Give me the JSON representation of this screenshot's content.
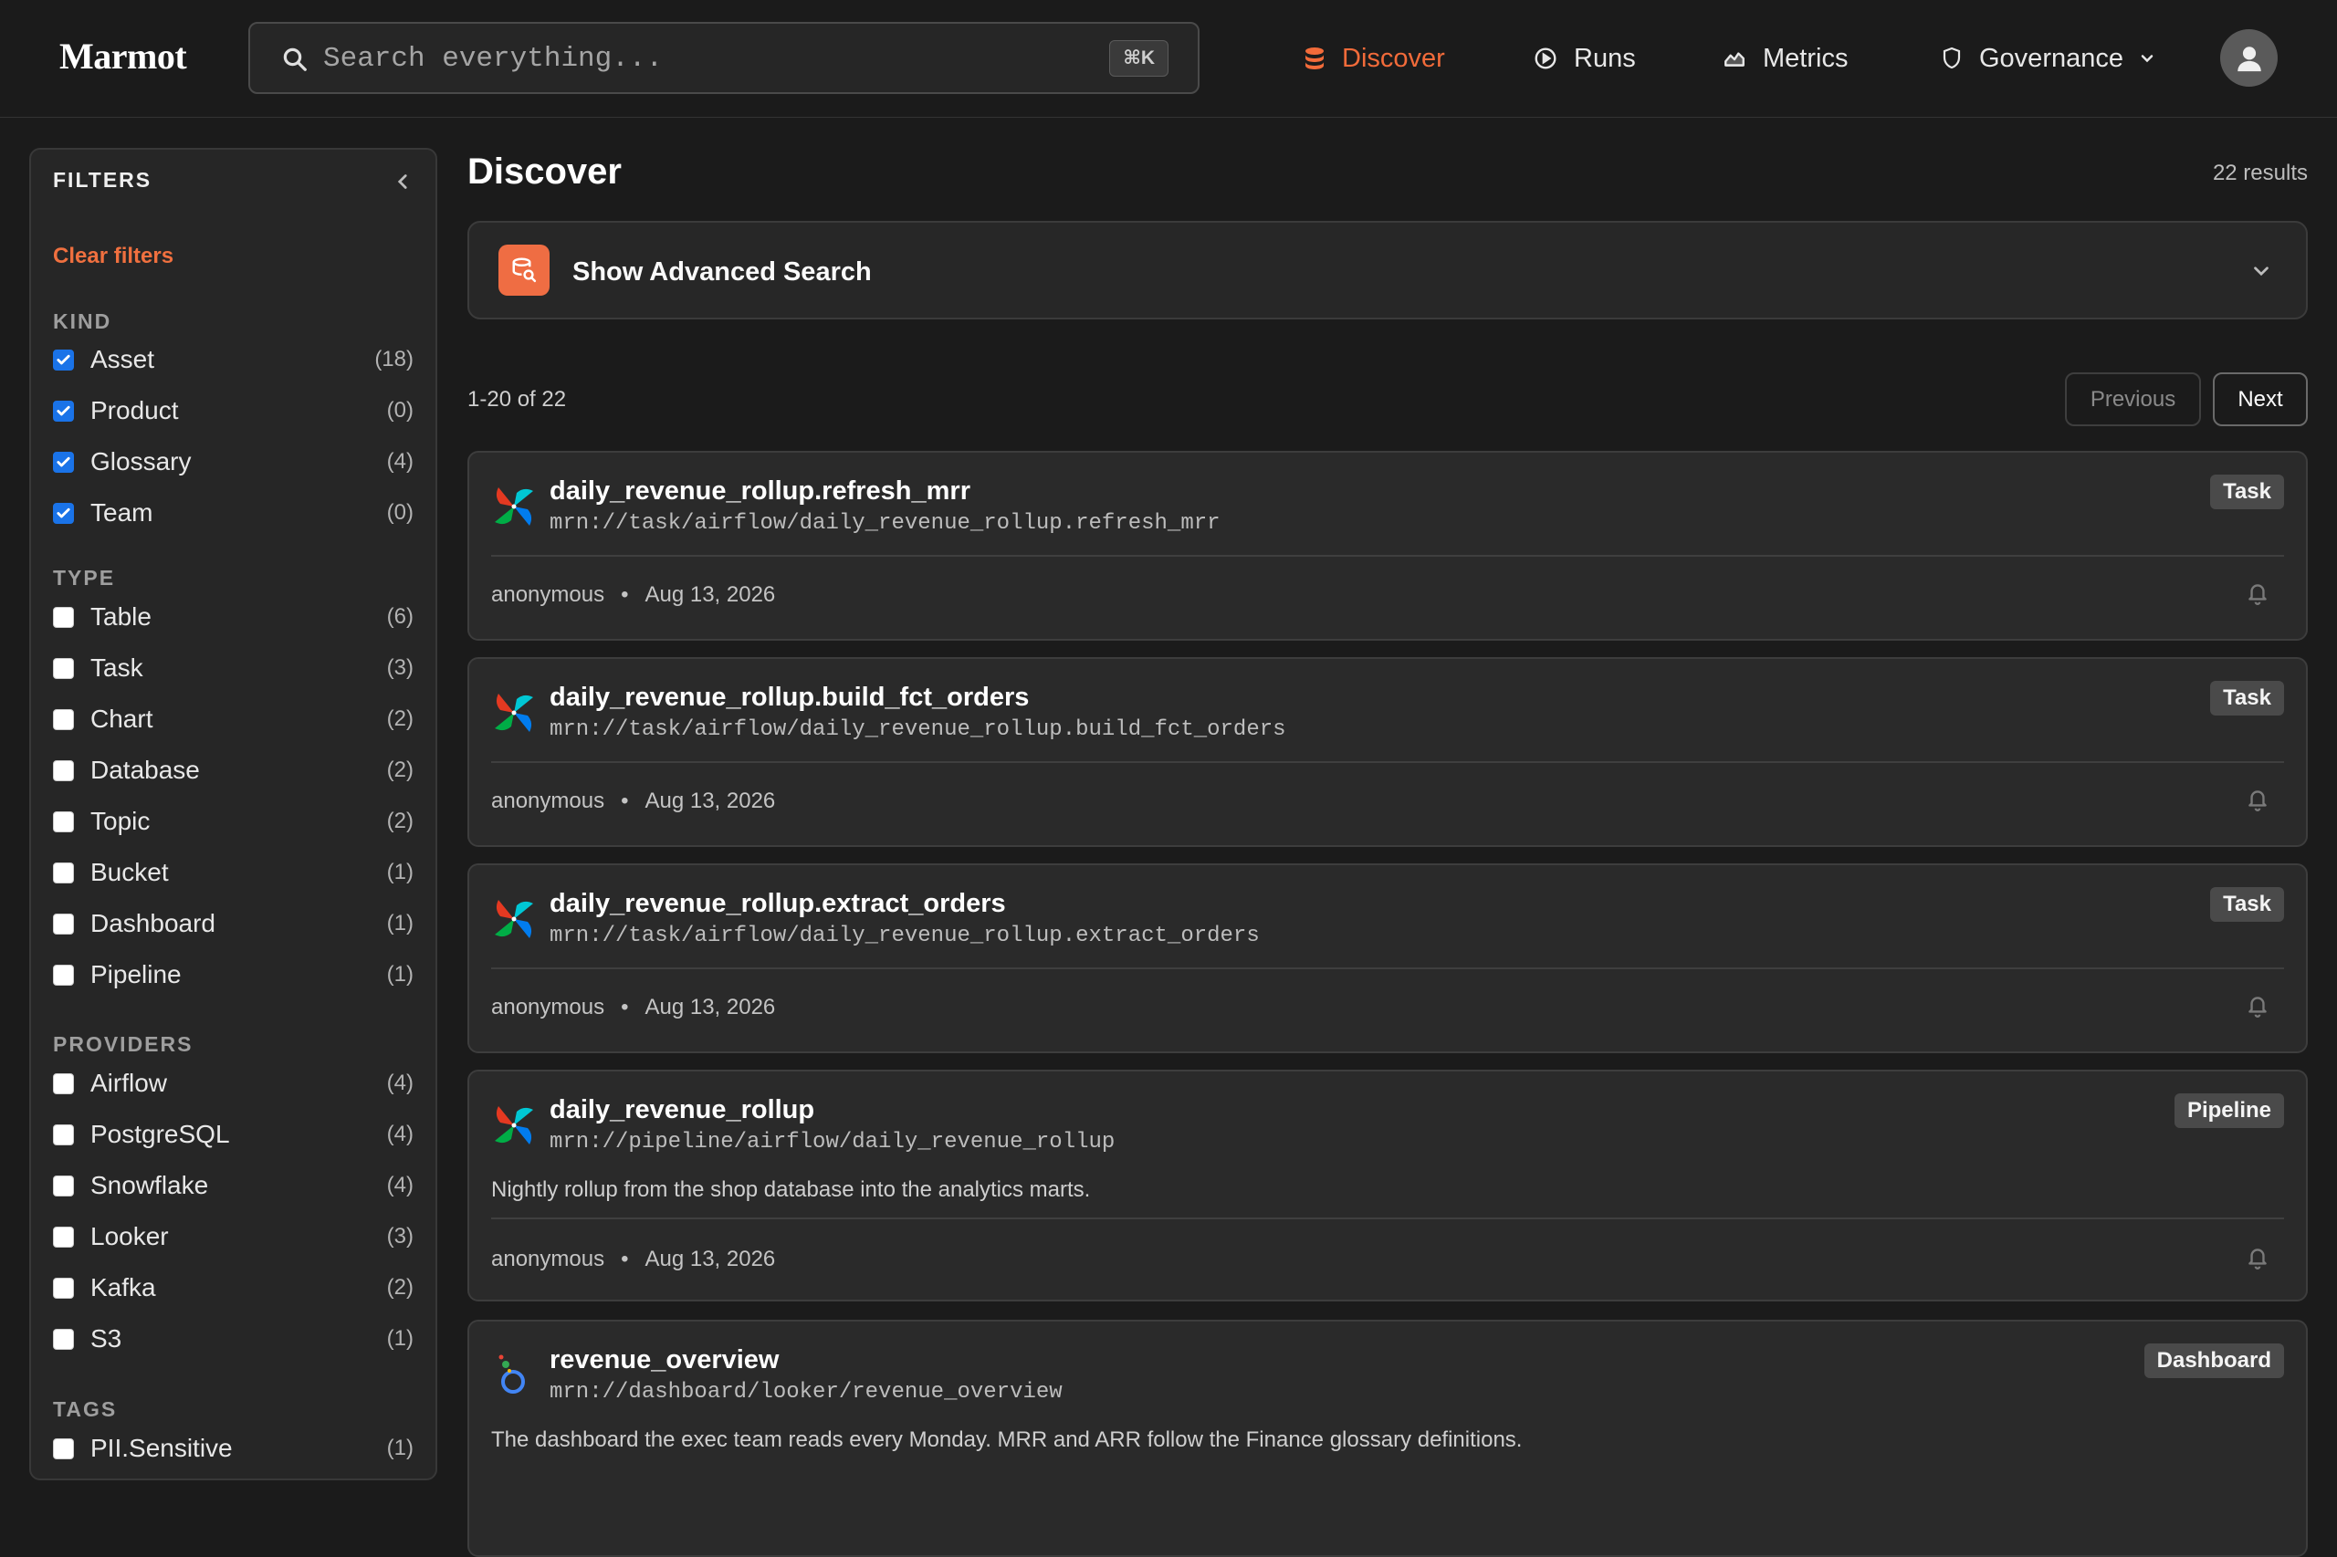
{
  "header": {
    "logo": "Marmot",
    "search_placeholder": "Search everything...",
    "shortcut": "⌘K",
    "nav": [
      {
        "label": "Discover",
        "icon": "database-icon",
        "active": true
      },
      {
        "label": "Runs",
        "icon": "play-circle-icon",
        "active": false
      },
      {
        "label": "Metrics",
        "icon": "chart-icon",
        "active": false
      },
      {
        "label": "Governance",
        "icon": "shield-icon",
        "active": false
      }
    ]
  },
  "sidebar": {
    "title": "FILTERS",
    "clear": "Clear filters",
    "sections": [
      {
        "label": "KIND",
        "items": [
          {
            "label": "Asset",
            "count": "(18)",
            "checked": true
          },
          {
            "label": "Product",
            "count": "(0)",
            "checked": true
          },
          {
            "label": "Glossary",
            "count": "(4)",
            "checked": true
          },
          {
            "label": "Team",
            "count": "(0)",
            "checked": true
          }
        ]
      },
      {
        "label": "TYPE",
        "items": [
          {
            "label": "Table",
            "count": "(6)",
            "checked": false
          },
          {
            "label": "Task",
            "count": "(3)",
            "checked": false
          },
          {
            "label": "Chart",
            "count": "(2)",
            "checked": false
          },
          {
            "label": "Database",
            "count": "(2)",
            "checked": false
          },
          {
            "label": "Topic",
            "count": "(2)",
            "checked": false
          },
          {
            "label": "Bucket",
            "count": "(1)",
            "checked": false
          },
          {
            "label": "Dashboard",
            "count": "(1)",
            "checked": false
          },
          {
            "label": "Pipeline",
            "count": "(1)",
            "checked": false
          }
        ]
      },
      {
        "label": "PROVIDERS",
        "items": [
          {
            "label": "Airflow",
            "count": "(4)",
            "checked": false
          },
          {
            "label": "PostgreSQL",
            "count": "(4)",
            "checked": false
          },
          {
            "label": "Snowflake",
            "count": "(4)",
            "checked": false
          },
          {
            "label": "Looker",
            "count": "(3)",
            "checked": false
          },
          {
            "label": "Kafka",
            "count": "(2)",
            "checked": false
          },
          {
            "label": "S3",
            "count": "(1)",
            "checked": false
          }
        ]
      },
      {
        "label": "TAGS",
        "items": [
          {
            "label": "PII.Sensitive",
            "count": "(1)",
            "checked": false
          }
        ]
      }
    ]
  },
  "main": {
    "title": "Discover",
    "results": "22 results",
    "advanced": "Show Advanced Search",
    "range": "1-20 of 22",
    "prev": "Previous",
    "next": "Next",
    "cards": [
      {
        "title": "daily_revenue_rollup.refresh_mrr",
        "mrn": "mrn://task/airflow/daily_revenue_rollup.refresh_mrr",
        "badge": "Task",
        "owner": "anonymous",
        "date": "Aug 13, 2026",
        "desc": "",
        "provider": "airflow"
      },
      {
        "title": "daily_revenue_rollup.build_fct_orders",
        "mrn": "mrn://task/airflow/daily_revenue_rollup.build_fct_orders",
        "badge": "Task",
        "owner": "anonymous",
        "date": "Aug 13, 2026",
        "desc": "",
        "provider": "airflow"
      },
      {
        "title": "daily_revenue_rollup.extract_orders",
        "mrn": "mrn://task/airflow/daily_revenue_rollup.extract_orders",
        "badge": "Task",
        "owner": "anonymous",
        "date": "Aug 13, 2026",
        "desc": "",
        "provider": "airflow"
      },
      {
        "title": "daily_revenue_rollup",
        "mrn": "mrn://pipeline/airflow/daily_revenue_rollup",
        "badge": "Pipeline",
        "owner": "anonymous",
        "date": "Aug 13, 2026",
        "desc": "Nightly rollup from the shop database into the analytics marts.",
        "provider": "airflow"
      },
      {
        "title": "revenue_overview",
        "mrn": "mrn://dashboard/looker/revenue_overview",
        "badge": "Dashboard",
        "owner": "",
        "date": "",
        "desc": "The dashboard the exec team reads every Monday. MRR and ARR follow the Finance glossary definitions.",
        "provider": "looker"
      }
    ]
  },
  "colors": {
    "accent": "#f26b3a",
    "checkbox": "#1a73e8",
    "background": "#1b1b1b",
    "card": "#2a2a2a"
  }
}
